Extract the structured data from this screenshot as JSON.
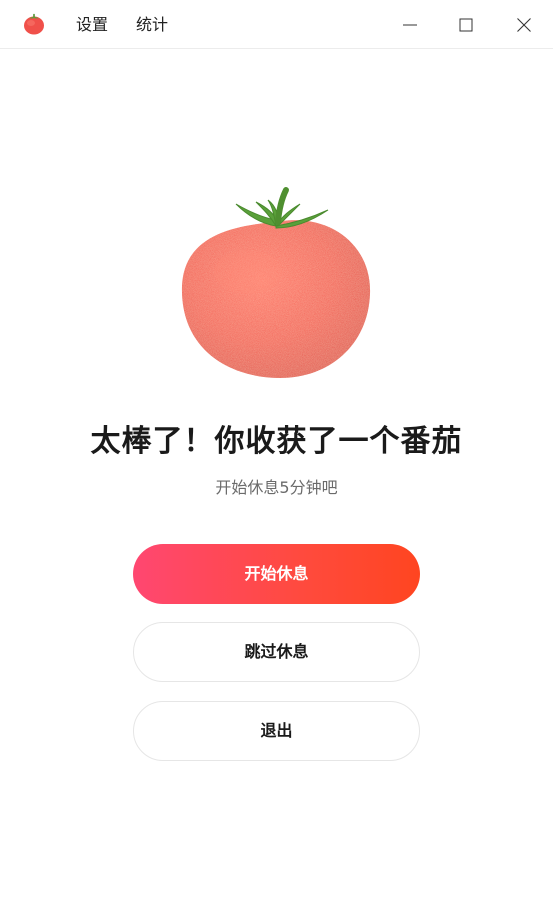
{
  "titlebar": {
    "logo_icon": "tomato-icon",
    "menu": {
      "settings": "设置",
      "stats": "统计"
    },
    "controls": [
      "minimize-icon",
      "maximize-icon",
      "close-icon"
    ]
  },
  "main": {
    "illustration_icon": "tomato-illustration",
    "headline": "太棒了！你收获了一个番茄",
    "subline": "开始休息5分钟吧",
    "buttons": {
      "start_break": "开始休息",
      "skip_break": "跳过休息",
      "exit": "退出"
    }
  },
  "colors": {
    "primary_gradient_start": "#ff4771",
    "primary_gradient_end": "#ff4520",
    "tomato": "#f2554a",
    "stem": "#5aa03a"
  }
}
